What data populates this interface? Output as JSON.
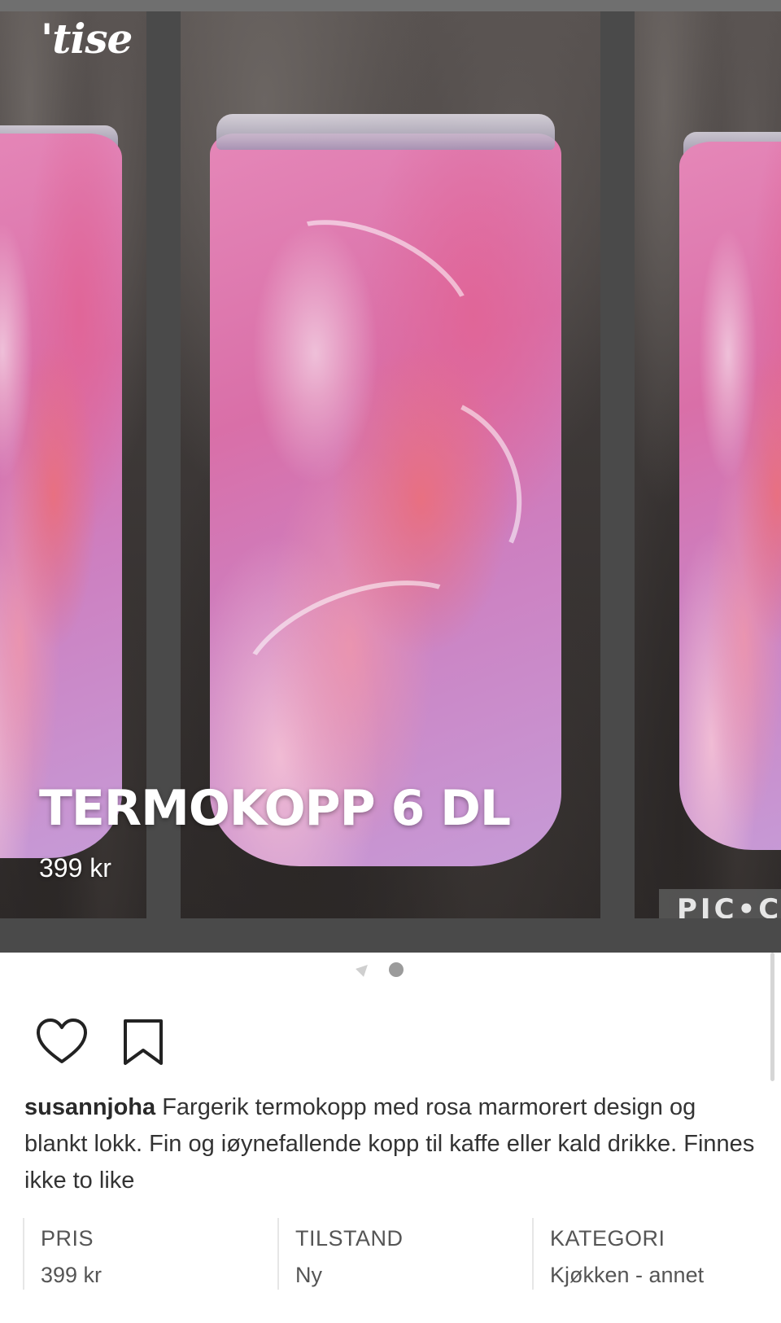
{
  "logo": "'tise",
  "listing": {
    "title": "TERMOKOPP 6 DL",
    "price_overlay": "399 kr",
    "watermark": "PIC•C"
  },
  "carousel": {
    "slides": 2,
    "active": 2
  },
  "actions": {
    "like_icon": "heart-outline-icon",
    "save_icon": "bookmark-outline-icon"
  },
  "description": {
    "username": "susannjoha",
    "text": "Fargerik termokopp med rosa marmorert design og blankt lokk. Fin og iøynefallende kopp til kaffe eller kald drikke. Finnes ikke to like"
  },
  "info": [
    {
      "label": "PRIS",
      "value": "399 kr"
    },
    {
      "label": "TILSTAND",
      "value": "Ny"
    },
    {
      "label": "KATEGORI",
      "value": "Kjøkken - annet"
    }
  ],
  "colors": {
    "background": "#ffffff",
    "text": "#333333",
    "muted": "#555555",
    "divider": "#e6e6e6"
  }
}
